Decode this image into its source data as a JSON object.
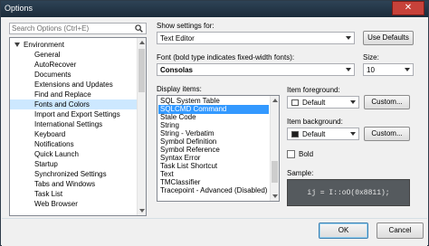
{
  "window": {
    "title": "Options",
    "close_glyph": "✕"
  },
  "search": {
    "placeholder": "Search Options (Ctrl+E)"
  },
  "tree": {
    "root": "Environment",
    "items": [
      "General",
      "AutoRecover",
      "Documents",
      "Extensions and Updates",
      "Find and Replace",
      "Fonts and Colors",
      "Import and Export Settings",
      "International Settings",
      "Keyboard",
      "Notifications",
      "Quick Launch",
      "Startup",
      "Synchronized Settings",
      "Tabs and Windows",
      "Task List",
      "Web Browser"
    ],
    "selected": "Fonts and Colors"
  },
  "settings": {
    "show_settings_label": "Show settings for:",
    "show_settings_value": "Text Editor",
    "use_defaults_label": "Use Defaults",
    "font_label": "Font (bold type indicates fixed-width fonts):",
    "font_value": "Consolas",
    "size_label": "Size:",
    "size_value": "10",
    "display_items_label": "Display items:",
    "display_items": [
      "SQL System Table",
      "SQLCMD Command",
      "Stale Code",
      "String",
      "String - Verbatim",
      "Symbol Definition",
      "Symbol Reference",
      "Syntax Error",
      "Task List Shortcut",
      "Text",
      "TMClassifier",
      "Tracepoint - Advanced (Disabled)"
    ],
    "selected_item": "SQLCMD Command",
    "fg_label": "Item foreground:",
    "fg_value": "Default",
    "bg_label": "Item background:",
    "bg_value": "Default",
    "custom_label": "Custom...",
    "bold_label": "Bold",
    "bold_checked": false,
    "sample_label": "Sample:",
    "sample_text": "ij = I::oO(0x8811);"
  },
  "footer": {
    "ok_label": "OK",
    "cancel_label": "Cancel"
  },
  "colors": {
    "selection": "#3399ff",
    "tree_selection": "#cde8ff",
    "sample_bg": "#555a5e",
    "titlebar": "#1b2b3a"
  },
  "icons": {
    "search": "search-icon",
    "close": "close-icon"
  }
}
